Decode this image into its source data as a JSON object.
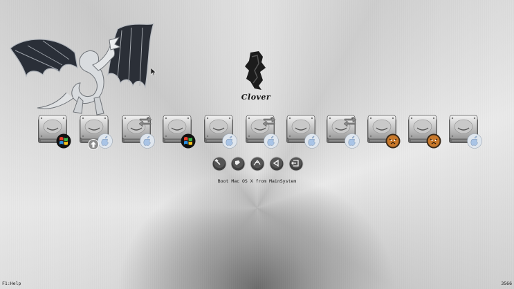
{
  "title": "Clover",
  "selected_entry_label": "Boot Mac OS X from MainSystem",
  "footer": {
    "help": "F1:Help",
    "revision": "3566"
  },
  "entries": [
    {
      "icon": "hard-disk-icon",
      "badge": "windows-logo-icon",
      "selected": false
    },
    {
      "icon": "hard-disk-icon",
      "badge": "apple-logo-icon",
      "secondary_badge": "upload-icon",
      "selected": true
    },
    {
      "icon": "hard-disk-icon",
      "badge": "apple-logo-icon",
      "overlay": "recovery-arrows-icon",
      "selected": false
    },
    {
      "icon": "hard-disk-icon",
      "badge": "windows-logo-icon",
      "selected": false
    },
    {
      "icon": "hard-disk-icon",
      "badge": "apple-logo-icon",
      "selected": false
    },
    {
      "icon": "hard-disk-icon",
      "badge": "apple-logo-icon",
      "overlay": "recovery-arrows-icon",
      "selected": false
    },
    {
      "icon": "hard-disk-icon",
      "badge": "apple-logo-icon",
      "selected": false
    },
    {
      "icon": "hard-disk-icon",
      "badge": "apple-logo-icon",
      "overlay": "recovery-arrows-icon",
      "selected": false
    },
    {
      "icon": "hard-disk-icon",
      "badge": "tiger-logo-icon",
      "selected": false
    },
    {
      "icon": "hard-disk-icon",
      "badge": "tiger-logo-icon",
      "selected": false
    },
    {
      "icon": "hard-disk-icon",
      "badge": "apple-logo-icon",
      "selected": false
    }
  ],
  "tools": [
    {
      "icon": "options-wrench-icon"
    },
    {
      "icon": "about-icon"
    },
    {
      "icon": "shell-icon"
    },
    {
      "icon": "reboot-icon"
    },
    {
      "icon": "exit-icon"
    }
  ],
  "colors": {
    "text": "#151515",
    "windows_red": "#e8402a",
    "windows_green": "#3eb54a",
    "windows_blue": "#2b8fe0",
    "windows_yellow": "#f6c21c",
    "tiger_orange": "#c8782a",
    "apple_blue": "#a9c4e6"
  }
}
